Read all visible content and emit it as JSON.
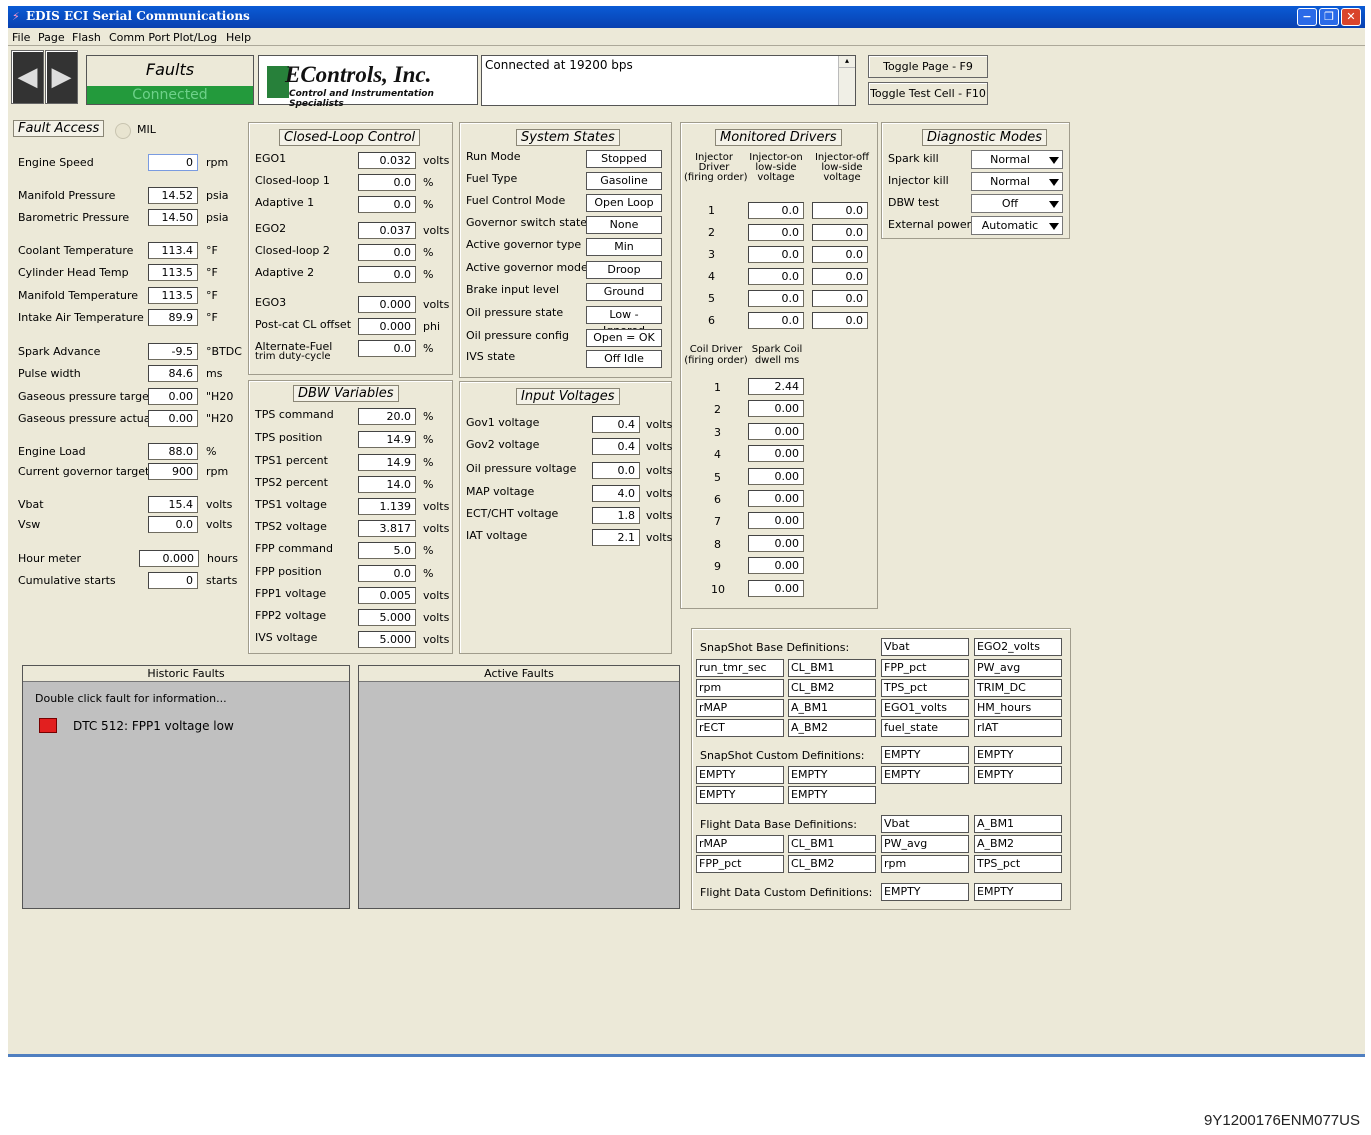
{
  "window": {
    "title": "EDIS ECI Serial Communications"
  },
  "menu": [
    "File",
    "Page",
    "Flash",
    "Comm Port",
    "Plot/Log",
    "Help"
  ],
  "toolbar": {
    "page_name": "Faults",
    "conn_status": "Connected",
    "logo_name": "EControls, Inc.",
    "logo_tag": "Control and Instrumentation Specialists",
    "message": "Connected at 19200 bps",
    "toggle_page": "Toggle Page - F9",
    "toggle_test": "Toggle Test Cell - F10"
  },
  "faultaccess": {
    "title": "Fault Access",
    "mil": "MIL",
    "rows": [
      {
        "label": "Engine Speed",
        "value": "0",
        "unit": "rpm"
      },
      {
        "label": "Manifold Pressure",
        "value": "14.52",
        "unit": "psia"
      },
      {
        "label": "Barometric Pressure",
        "value": "14.50",
        "unit": "psia"
      },
      {
        "label": "Coolant Temperature",
        "value": "113.4",
        "unit": "°F"
      },
      {
        "label": "Cylinder Head Temp",
        "value": "113.5",
        "unit": "°F"
      },
      {
        "label": "Manifold Temperature",
        "value": "113.5",
        "unit": "°F"
      },
      {
        "label": "Intake Air Temperature",
        "value": "89.9",
        "unit": "°F"
      },
      {
        "label": "Spark Advance",
        "value": "-9.5",
        "unit": "°BTDC"
      },
      {
        "label": "Pulse width",
        "value": "84.6",
        "unit": "ms"
      },
      {
        "label": "Gaseous pressure target",
        "value": "0.00",
        "unit": "\"H20"
      },
      {
        "label": "Gaseous pressure actual",
        "value": "0.00",
        "unit": "\"H20"
      },
      {
        "label": "Engine Load",
        "value": "88.0",
        "unit": "%"
      },
      {
        "label": "Current governor target",
        "value": "900",
        "unit": "rpm"
      },
      {
        "label": "Vbat",
        "value": "15.4",
        "unit": "volts"
      },
      {
        "label": "Vsw",
        "value": "0.0",
        "unit": "volts"
      },
      {
        "label": "Hour meter",
        "value": "0.000",
        "unit": "hours"
      },
      {
        "label": "Cumulative starts",
        "value": "0",
        "unit": "starts"
      }
    ]
  },
  "closedloop": {
    "title": "Closed-Loop Control",
    "rows": [
      {
        "label": "EGO1",
        "value": "0.032",
        "unit": "volts"
      },
      {
        "label": "Closed-loop 1",
        "value": "0.0",
        "unit": "%"
      },
      {
        "label": "Adaptive 1",
        "value": "0.0",
        "unit": "%"
      },
      {
        "label": "EGO2",
        "value": "0.037",
        "unit": "volts"
      },
      {
        "label": "Closed-loop 2",
        "value": "0.0",
        "unit": "%"
      },
      {
        "label": "Adaptive 2",
        "value": "0.0",
        "unit": "%"
      },
      {
        "label": "EGO3",
        "value": "0.000",
        "unit": "volts"
      },
      {
        "label": "Post-cat CL offset",
        "value": "0.000",
        "unit": "phi"
      },
      {
        "label": "Alternate-Fuel",
        "label2": "trim duty-cycle",
        "value": "0.0",
        "unit": "%"
      }
    ]
  },
  "dbw": {
    "title": "DBW Variables",
    "rows": [
      {
        "label": "TPS command",
        "value": "20.0",
        "unit": "%"
      },
      {
        "label": "TPS position",
        "value": "14.9",
        "unit": "%"
      },
      {
        "label": "TPS1 percent",
        "value": "14.9",
        "unit": "%"
      },
      {
        "label": "TPS2 percent",
        "value": "14.0",
        "unit": "%"
      },
      {
        "label": "TPS1 voltage",
        "value": "1.139",
        "unit": "volts"
      },
      {
        "label": "TPS2 voltage",
        "value": "3.817",
        "unit": "volts"
      },
      {
        "label": "FPP command",
        "value": "5.0",
        "unit": "%"
      },
      {
        "label": "FPP position",
        "value": "0.0",
        "unit": "%"
      },
      {
        "label": "FPP1 voltage",
        "value": "0.005",
        "unit": "volts"
      },
      {
        "label": "FPP2 voltage",
        "value": "5.000",
        "unit": "volts"
      },
      {
        "label": "IVS voltage",
        "value": "5.000",
        "unit": "volts"
      }
    ]
  },
  "systemstates": {
    "title": "System States",
    "rows": [
      {
        "label": "Run Mode",
        "value": "Stopped"
      },
      {
        "label": "Fuel Type",
        "value": "Gasoline"
      },
      {
        "label": "Fuel Control Mode",
        "value": "Open Loop"
      },
      {
        "label": "Governor switch state",
        "value": "None"
      },
      {
        "label": "Active governor type",
        "value": "Min"
      },
      {
        "label": "Active governor mode",
        "value": "Droop"
      },
      {
        "label": "Brake input level",
        "value": "Ground"
      },
      {
        "label": "Oil pressure state",
        "value": "Low - Ignored"
      },
      {
        "label": "Oil pressure config",
        "value": "Open = OK"
      },
      {
        "label": "IVS state",
        "value": "Off Idle"
      }
    ]
  },
  "inputvoltages": {
    "title": "Input Voltages",
    "rows": [
      {
        "label": "Gov1 voltage",
        "value": "0.4",
        "unit": "volts"
      },
      {
        "label": "Gov2 voltage",
        "value": "0.4",
        "unit": "volts"
      },
      {
        "label": "Oil pressure voltage",
        "value": "0.0",
        "unit": "volts"
      },
      {
        "label": "MAP voltage",
        "value": "4.0",
        "unit": "volts"
      },
      {
        "label": "ECT/CHT voltage",
        "value": "1.8",
        "unit": "volts"
      },
      {
        "label": "IAT voltage",
        "value": "2.1",
        "unit": "volts"
      }
    ]
  },
  "drivers": {
    "title": "Monitored Drivers",
    "hdr_injector": [
      "Injector",
      "Driver",
      "(firing order)"
    ],
    "hdr_on": [
      "Injector-on",
      "low-side",
      "voltage"
    ],
    "hdr_off": [
      "Injector-off",
      "low-side",
      "voltage"
    ],
    "injectors": [
      {
        "n": "1",
        "on": "0.0",
        "off": "0.0"
      },
      {
        "n": "2",
        "on": "0.0",
        "off": "0.0"
      },
      {
        "n": "3",
        "on": "0.0",
        "off": "0.0"
      },
      {
        "n": "4",
        "on": "0.0",
        "off": "0.0"
      },
      {
        "n": "5",
        "on": "0.0",
        "off": "0.0"
      },
      {
        "n": "6",
        "on": "0.0",
        "off": "0.0"
      }
    ],
    "hdr_coil": [
      "Coil Driver",
      "(firing order)"
    ],
    "hdr_dwell": [
      "Spark Coil",
      "dwell ms"
    ],
    "coils": [
      {
        "n": "1",
        "v": "2.44"
      },
      {
        "n": "2",
        "v": "0.00"
      },
      {
        "n": "3",
        "v": "0.00"
      },
      {
        "n": "4",
        "v": "0.00"
      },
      {
        "n": "5",
        "v": "0.00"
      },
      {
        "n": "6",
        "v": "0.00"
      },
      {
        "n": "7",
        "v": "0.00"
      },
      {
        "n": "8",
        "v": "0.00"
      },
      {
        "n": "9",
        "v": "0.00"
      },
      {
        "n": "10",
        "v": "0.00"
      }
    ]
  },
  "diag": {
    "title": "Diagnostic Modes",
    "rows": [
      {
        "label": "Spark kill",
        "value": "Normal"
      },
      {
        "label": "Injector kill",
        "value": "Normal"
      },
      {
        "label": "DBW test",
        "value": "Off"
      },
      {
        "label": "External power",
        "value": "Automatic"
      }
    ]
  },
  "historic": {
    "title": "Historic Faults",
    "hint": "Double click fault for information...",
    "faults": [
      "DTC 512: FPP1 voltage low"
    ]
  },
  "active": {
    "title": "Active Faults"
  },
  "snapshot": {
    "base_title": "SnapShot Base Definitions:",
    "base_top": [
      "Vbat",
      "EGO2_volts"
    ],
    "base_rows": [
      [
        "run_tmr_sec",
        "CL_BM1",
        "FPP_pct",
        "PW_avg"
      ],
      [
        "rpm",
        "CL_BM2",
        "TPS_pct",
        "TRIM_DC"
      ],
      [
        "rMAP",
        "A_BM1",
        "EGO1_volts",
        "HM_hours"
      ],
      [
        "rECT",
        "A_BM2",
        "fuel_state",
        "rIAT"
      ]
    ],
    "custom_title": "SnapShot Custom Definitions:",
    "custom_top": [
      "EMPTY",
      "EMPTY"
    ],
    "custom_rows": [
      [
        "EMPTY",
        "EMPTY",
        "EMPTY",
        "EMPTY"
      ],
      [
        "EMPTY",
        "EMPTY"
      ]
    ],
    "flight_title": "Flight Data Base Definitions:",
    "flight_top": [
      "Vbat",
      "A_BM1"
    ],
    "flight_rows": [
      [
        "rMAP",
        "CL_BM1",
        "PW_avg",
        "A_BM2"
      ],
      [
        "FPP_pct",
        "CL_BM2",
        "rpm",
        "TPS_pct"
      ]
    ],
    "fcustom_title": "Flight Data Custom Definitions:",
    "fcustom_top": [
      "EMPTY",
      "EMPTY"
    ]
  },
  "footer": {
    "code": "9Y1200176ENM077US"
  }
}
